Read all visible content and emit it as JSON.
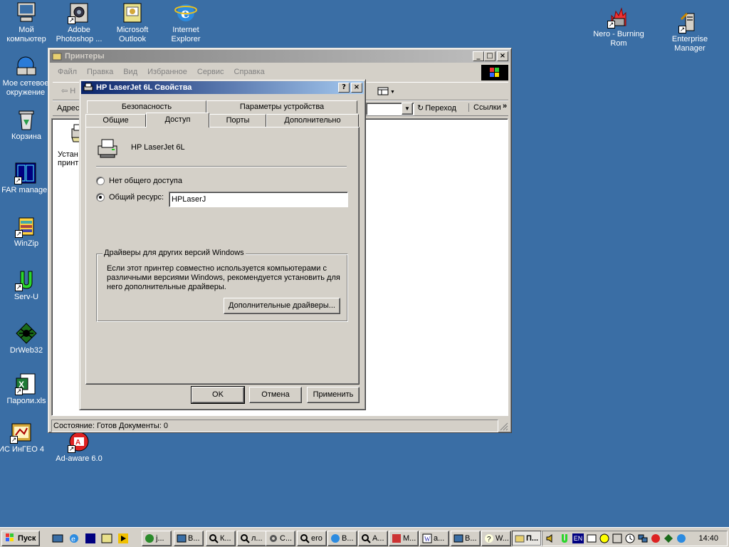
{
  "desktop": {
    "icons": [
      {
        "label": "Мой компьютер"
      },
      {
        "label": "Adobe Photoshop ..."
      },
      {
        "label": "Microsoft Outlook"
      },
      {
        "label": "Internet Explorer"
      },
      {
        "label": "Мое сетевое окружение"
      },
      {
        "label": "Корзина"
      },
      {
        "label": "FAR manager"
      },
      {
        "label": "WinZip"
      },
      {
        "label": "Serv-U"
      },
      {
        "label": "DrWeb32"
      },
      {
        "label": "Пароли.xls"
      },
      {
        "label": "ИС ИнГЕО 4"
      },
      {
        "label": "Ad-aware 6.0"
      },
      {
        "label": "Nero - Burning Rom"
      },
      {
        "label": "Enterprise Manager"
      }
    ]
  },
  "explorer": {
    "title": "Принтеры",
    "menu": [
      "Файл",
      "Правка",
      "Вид",
      "Избранное",
      "Сервис",
      "Справка"
    ],
    "back_label": "Н",
    "address_label": "Адрес",
    "go_label": "Переход",
    "links_label": "Ссылки",
    "item_label_line1": "Устан",
    "item_label_line2": "принт",
    "status": "Состояние: Готов Документы: 0"
  },
  "dialog": {
    "title": "HP LaserJet 6L Свойства",
    "help_btn": "?",
    "close_btn": "×",
    "tabs_back": [
      "Безопасность",
      "Параметры устройства"
    ],
    "tabs_front": [
      "Общие",
      "Доступ",
      "Порты",
      "Дополнительно"
    ],
    "selected_tab": "Доступ",
    "printer_name": "HP LaserJet 6L",
    "radio_no_share": "Нет общего доступа",
    "radio_share": "Общий ресурс:",
    "share_value": "HPLaserJ",
    "share_selected": true,
    "drivers_group_title": "Драйверы для других версий Windows",
    "drivers_text": "Если этот принтер совместно используется компьютерами с различными версиями Windows, рекомендуется установить для него дополнительные драйверы.",
    "drivers_button": "Дополнительные драйверы...",
    "ok": "OK",
    "cancel": "Отмена",
    "apply": "Применить"
  },
  "taskbar": {
    "start_label": "Пуск",
    "tasks": [
      {
        "label": "j..."
      },
      {
        "label": "В..."
      },
      {
        "label": "К..."
      },
      {
        "label": "л..."
      },
      {
        "label": "С..."
      },
      {
        "label": "ero"
      },
      {
        "label": "В..."
      },
      {
        "label": "А..."
      },
      {
        "label": "М..."
      },
      {
        "label": "а..."
      },
      {
        "label": "В..."
      },
      {
        "label": "W..."
      },
      {
        "label": "П..."
      }
    ],
    "tray_lang": "EN",
    "clock": "14:40"
  },
  "colors": {
    "desktop": "#3a6ea5",
    "face": "#d4d0c8",
    "active_title_start": "#0a246a",
    "active_title_end": "#a6caf0"
  }
}
